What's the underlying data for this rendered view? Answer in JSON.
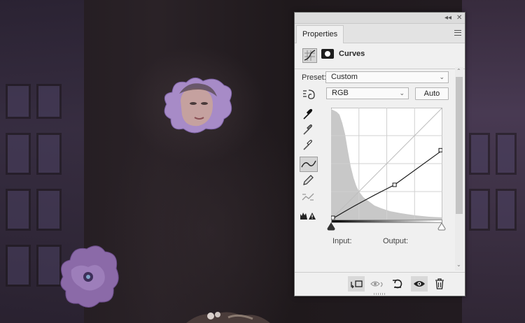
{
  "panel": {
    "tab_label": "Properties",
    "collapse_label": "◂◂",
    "close_label": "✕",
    "adjustment_title": "Curves",
    "preset_label": "Preset:",
    "preset_value": "Custom",
    "channel_value": "RGB",
    "auto_label": "Auto",
    "input_label": "Input:",
    "output_label": "Output:",
    "scroll_up": "⌃",
    "scroll_down": "⌄"
  },
  "tools": [
    {
      "name": "on-image-adjust-icon"
    },
    {
      "name": "black-point-eyedropper-icon"
    },
    {
      "name": "gray-point-eyedropper-icon"
    },
    {
      "name": "white-point-eyedropper-icon"
    },
    {
      "name": "edit-points-curve-icon",
      "selected": true
    },
    {
      "name": "pencil-draw-curve-icon"
    },
    {
      "name": "smooth-curve-icon"
    },
    {
      "name": "clipping-warning-icon"
    }
  ],
  "footer_buttons": [
    {
      "name": "clip-to-layer-button-icon",
      "selected": true
    },
    {
      "name": "view-previous-state-icon"
    },
    {
      "name": "reset-defaults-icon"
    },
    {
      "name": "toggle-visibility-icon",
      "selected": true
    },
    {
      "name": "delete-adjustment-icon"
    }
  ],
  "colors": {
    "panel_bg": "#f0f0f0",
    "curve": "#1a1a1a",
    "histogram": "#c8c8c8"
  },
  "curve_points": [
    {
      "input": 0,
      "output": 0
    },
    {
      "input": 0.57,
      "output": 0.31
    },
    {
      "input": 1.0,
      "output": 0.62
    }
  ]
}
